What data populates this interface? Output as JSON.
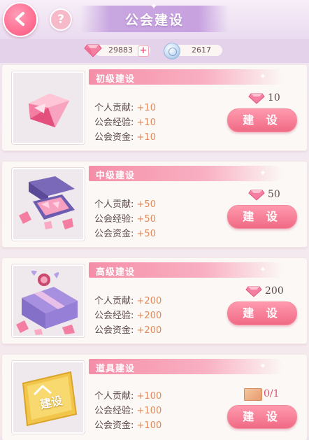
{
  "header": {
    "title": "公会建设",
    "help_label": "?"
  },
  "currency": {
    "gems": "29883",
    "gem_plus": "+",
    "coins": "2617"
  },
  "cards": [
    {
      "name": "初级建设",
      "stats": [
        {
          "label": "个人贡献:",
          "value": "+10"
        },
        {
          "label": "公会经验:",
          "value": "+10"
        },
        {
          "label": "公会资金:",
          "value": "+10"
        }
      ],
      "cost": "10",
      "button": "建 设",
      "image": "pink-gem-icon"
    },
    {
      "name": "中级建设",
      "stats": [
        {
          "label": "个人贡献:",
          "value": "+50"
        },
        {
          "label": "公会经验:",
          "value": "+50"
        },
        {
          "label": "公会资金:",
          "value": "+50"
        }
      ],
      "cost": "50",
      "button": "建 设",
      "image": "gem-box-icon"
    },
    {
      "name": "高级建设",
      "stats": [
        {
          "label": "个人贡献:",
          "value": "+200"
        },
        {
          "label": "公会经验:",
          "value": "+200"
        },
        {
          "label": "公会资金:",
          "value": "+200"
        }
      ],
      "cost": "200",
      "button": "建 设",
      "image": "gift-box-icon"
    },
    {
      "name": "道具建设",
      "stats": [
        {
          "label": "个人贡献:",
          "value": "+100"
        },
        {
          "label": "公会经验:",
          "value": "+100"
        },
        {
          "label": "公会资金:",
          "value": "+100"
        }
      ],
      "cost": "0/1",
      "button": "建 设",
      "image": "build-ticket-icon",
      "ticket_text": "建设"
    }
  ],
  "colors": {
    "accent_pink": "#f06a85",
    "ribbon_pink": "#f58ea8",
    "value_orange": "#e08a5a",
    "title_purple": "#c7a2df"
  }
}
